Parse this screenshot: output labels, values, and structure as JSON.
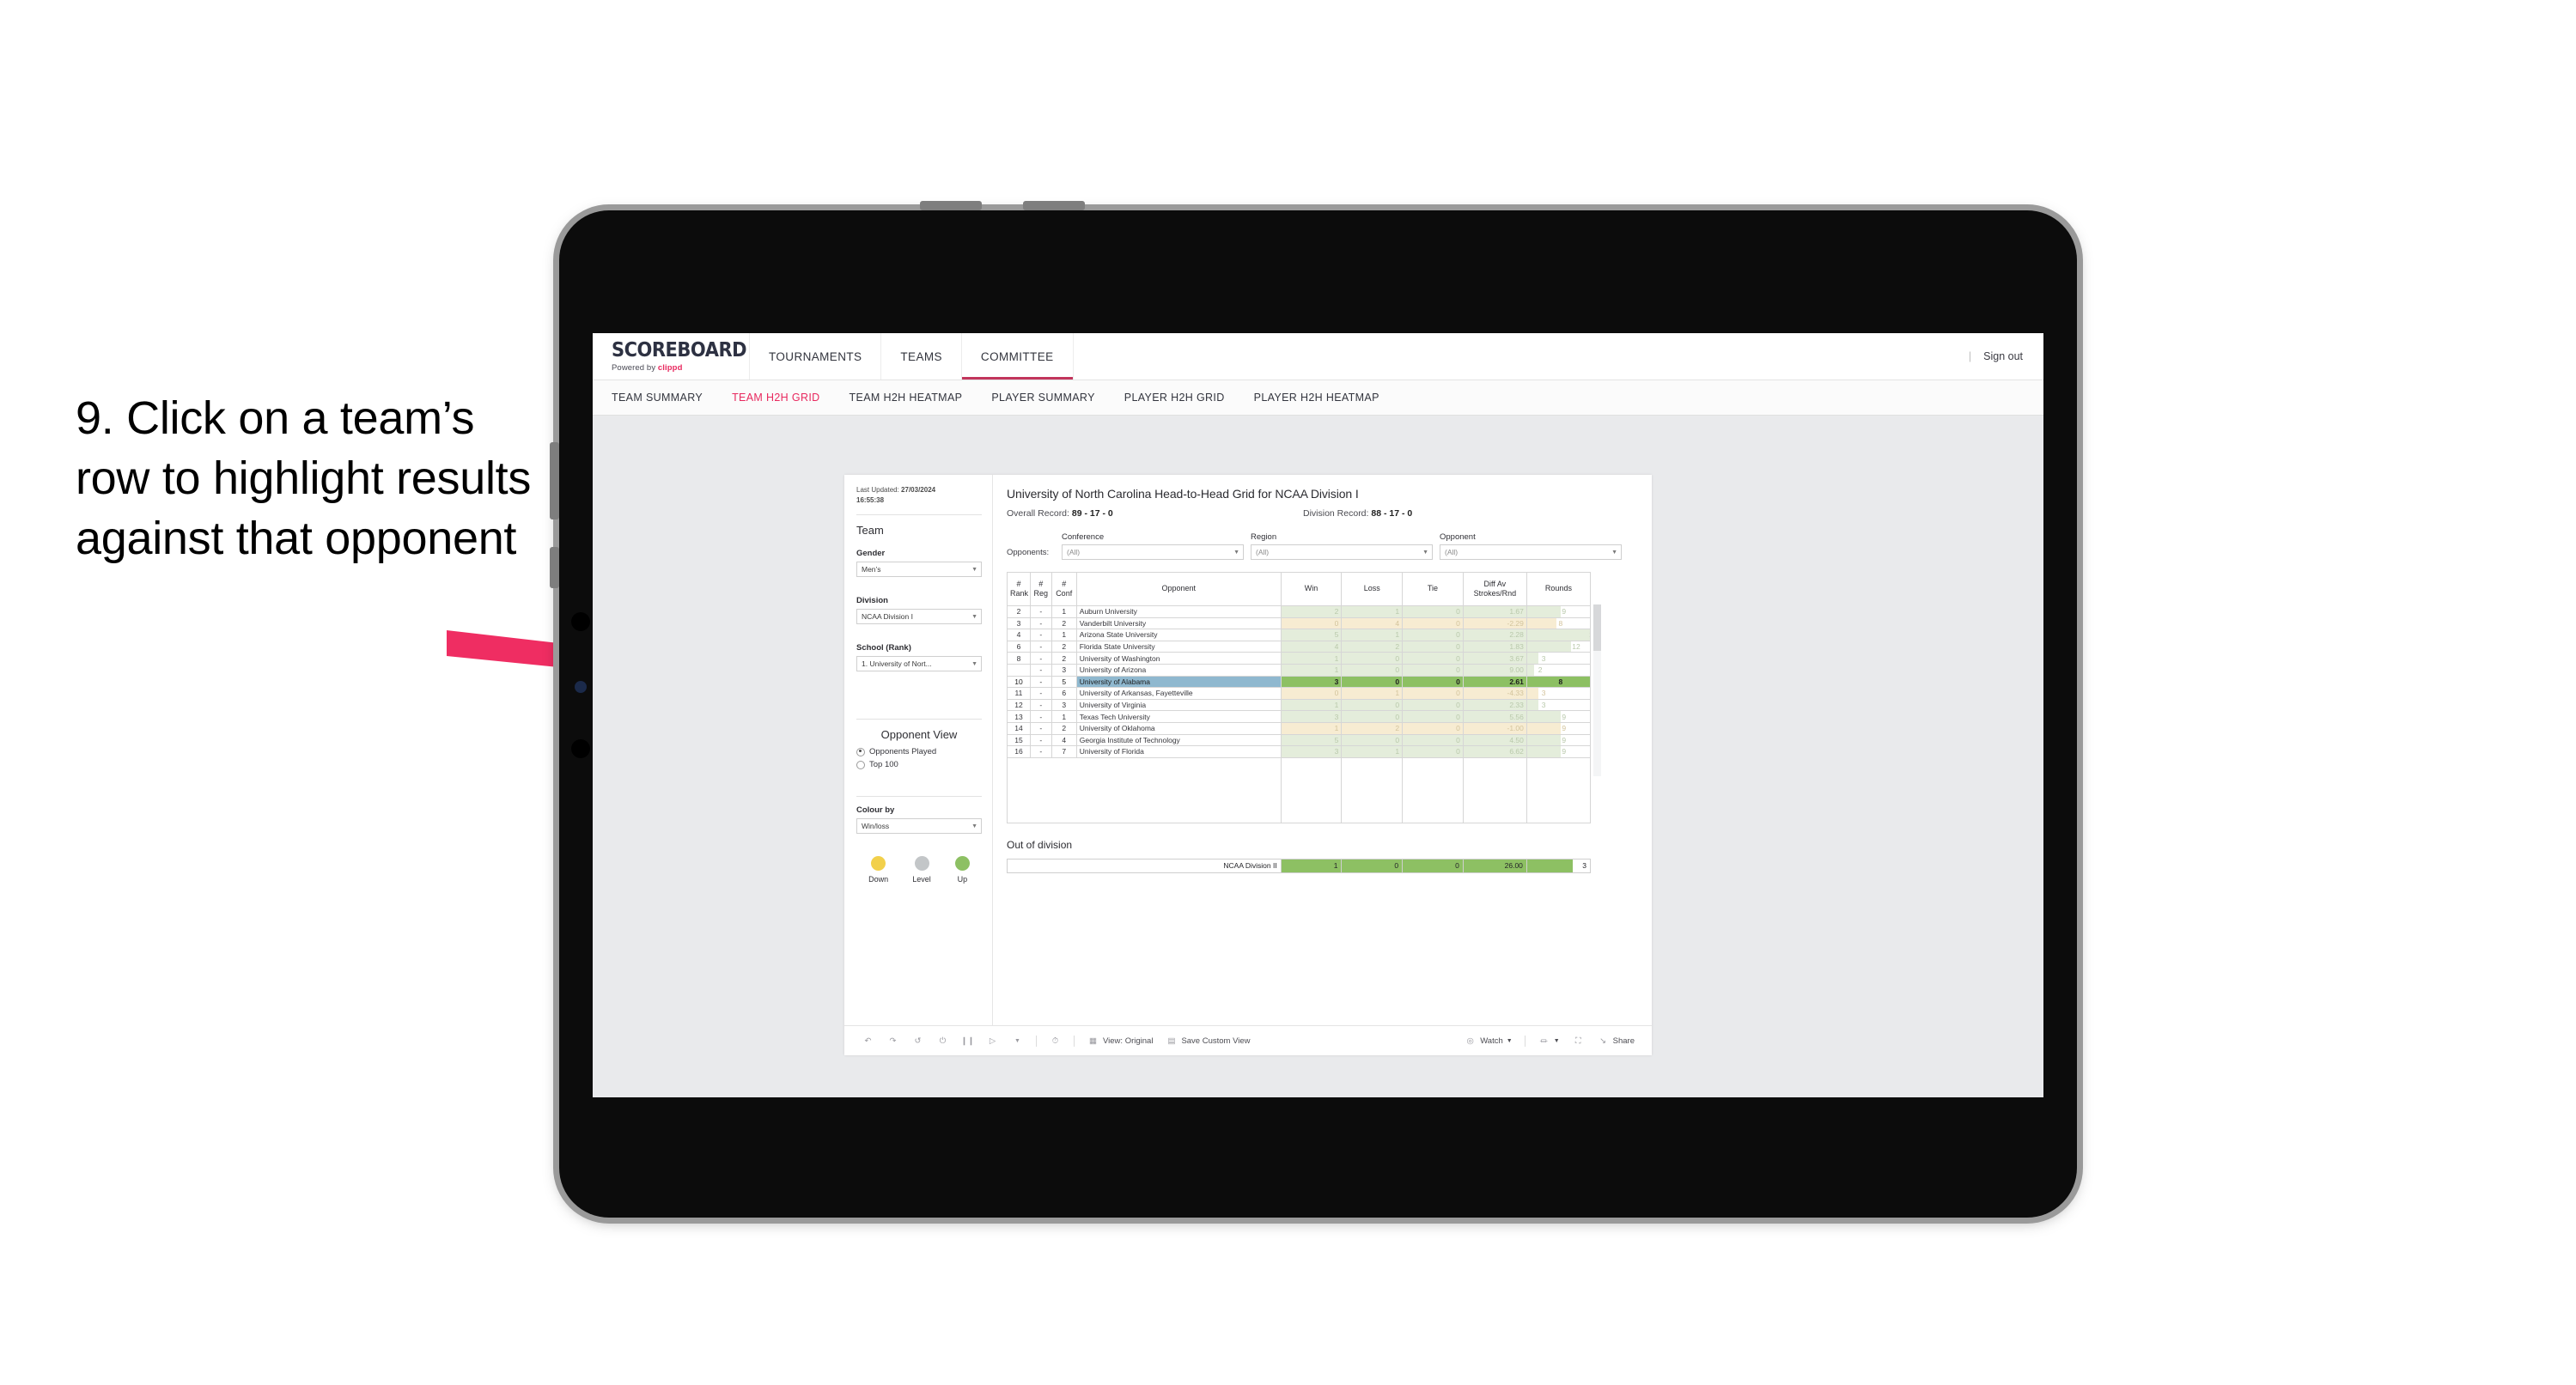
{
  "annotation": {
    "text": "9. Click on a team’s row to highlight results against that opponent",
    "arrow_color": "#ef2d62"
  },
  "topnav": {
    "logo_main": "SCOREBOARD",
    "logo_sub_prefix": "Powered by ",
    "logo_sub_brand": "clippd",
    "items": [
      {
        "label": "TOURNAMENTS",
        "active": false
      },
      {
        "label": "TEAMS",
        "active": false
      },
      {
        "label": "COMMITTEE",
        "active": true
      }
    ],
    "divider": "|",
    "sign_out": "Sign out"
  },
  "subnav": {
    "items": [
      {
        "label": "TEAM SUMMARY",
        "active": false
      },
      {
        "label": "TEAM H2H GRID",
        "active": true
      },
      {
        "label": "TEAM H2H HEATMAP",
        "active": false
      },
      {
        "label": "PLAYER SUMMARY",
        "active": false
      },
      {
        "label": "PLAYER H2H GRID",
        "active": false
      },
      {
        "label": "PLAYER H2H HEATMAP",
        "active": false
      }
    ]
  },
  "sidebar": {
    "last_updated_label": "Last Updated: ",
    "last_updated_date": "27/03/2024",
    "last_updated_time": "16:55:38",
    "team_title": "Team",
    "gender_label": "Gender",
    "gender_value": "Men’s",
    "division_label": "Division",
    "division_value": "NCAA Division I",
    "school_label": "School (Rank)",
    "school_value": "1. University of Nort...",
    "opponent_view_title": "Opponent View",
    "opponent_view_options": [
      {
        "label": "Opponents Played",
        "checked": true
      },
      {
        "label": "Top 100",
        "checked": false
      }
    ],
    "colour_by_label": "Colour by",
    "colour_by_value": "Win/loss",
    "legend": [
      {
        "label": "Down",
        "color": "#f2d04b"
      },
      {
        "label": "Level",
        "color": "#c3c6c8"
      },
      {
        "label": "Up",
        "color": "#8dc063"
      }
    ]
  },
  "main": {
    "title": "University of North Carolina Head-to-Head Grid for NCAA Division I",
    "overall_record_label": "Overall Record: ",
    "overall_record_value": "89 - 17 - 0",
    "division_record_label": "Division Record: ",
    "division_record_value": "88 - 17 - 0",
    "opponents_label": "Opponents:",
    "filters": [
      {
        "label": "Conference",
        "value": "(All)"
      },
      {
        "label": "Region",
        "value": "(All)"
      },
      {
        "label": "Opponent",
        "value": "(All)"
      }
    ],
    "out_of_division_title": "Out of division",
    "out_of_division_row": {
      "label": "NCAA Division II",
      "win": "1",
      "loss": "0",
      "tie": "0",
      "diff": "26.00",
      "rounds": "3"
    }
  },
  "chart_data": {
    "type": "table",
    "title": "University of North Carolina Head-to-Head Grid for NCAA Division I",
    "columns": [
      "# Rank",
      "# Reg",
      "# Conf",
      "Opponent",
      "Win",
      "Loss",
      "Tie",
      "Diff Av Strokes/Rnd",
      "Rounds"
    ],
    "header_lines": [
      [
        "#",
        "Rank"
      ],
      [
        "#",
        "Reg"
      ],
      [
        "#",
        "Conf"
      ],
      [
        "Opponent",
        ""
      ],
      [
        "Win",
        ""
      ],
      [
        "Loss",
        ""
      ],
      [
        "Tie",
        ""
      ],
      [
        "Diff Av",
        "Strokes/Rnd"
      ],
      [
        "Rounds",
        ""
      ]
    ],
    "rounds_max": 17,
    "rows": [
      {
        "rank": "2",
        "reg": "-",
        "conf": "1",
        "opponent": "Auburn University",
        "win": "2",
        "loss": "1",
        "tie": "0",
        "diff": "1.67",
        "rounds": "9",
        "tone": "up",
        "highlight": false
      },
      {
        "rank": "3",
        "reg": "-",
        "conf": "2",
        "opponent": "Vanderbilt University",
        "win": "0",
        "loss": "4",
        "tie": "0",
        "diff": "-2.29",
        "rounds": "8",
        "tone": "down",
        "highlight": false
      },
      {
        "rank": "4",
        "reg": "-",
        "conf": "1",
        "opponent": "Arizona State University",
        "win": "5",
        "loss": "1",
        "tie": "0",
        "diff": "2.28",
        "rounds": "17",
        "tone": "up",
        "highlight": false
      },
      {
        "rank": "6",
        "reg": "-",
        "conf": "2",
        "opponent": "Florida State University",
        "win": "4",
        "loss": "2",
        "tie": "0",
        "diff": "1.83",
        "rounds": "12",
        "tone": "up",
        "highlight": false
      },
      {
        "rank": "8",
        "reg": "-",
        "conf": "2",
        "opponent": "University of Washington",
        "win": "1",
        "loss": "0",
        "tie": "0",
        "diff": "3.67",
        "rounds": "3",
        "tone": "up",
        "highlight": false
      },
      {
        "rank": "",
        "reg": "-",
        "conf": "3",
        "opponent": "University of Arizona",
        "win": "1",
        "loss": "0",
        "tie": "0",
        "diff": "9.00",
        "rounds": "2",
        "tone": "up",
        "highlight": false
      },
      {
        "rank": "10",
        "reg": "-",
        "conf": "5",
        "opponent": "University of Alabama",
        "win": "3",
        "loss": "0",
        "tie": "0",
        "diff": "2.61",
        "rounds": "8",
        "tone": "up",
        "highlight": true
      },
      {
        "rank": "11",
        "reg": "-",
        "conf": "6",
        "opponent": "University of Arkansas, Fayetteville",
        "win": "0",
        "loss": "1",
        "tie": "0",
        "diff": "-4.33",
        "rounds": "3",
        "tone": "down",
        "highlight": false
      },
      {
        "rank": "12",
        "reg": "-",
        "conf": "3",
        "opponent": "University of Virginia",
        "win": "1",
        "loss": "0",
        "tie": "0",
        "diff": "2.33",
        "rounds": "3",
        "tone": "up",
        "highlight": false
      },
      {
        "rank": "13",
        "reg": "-",
        "conf": "1",
        "opponent": "Texas Tech University",
        "win": "3",
        "loss": "0",
        "tie": "0",
        "diff": "5.56",
        "rounds": "9",
        "tone": "up",
        "highlight": false
      },
      {
        "rank": "14",
        "reg": "-",
        "conf": "2",
        "opponent": "University of Oklahoma",
        "win": "1",
        "loss": "2",
        "tie": "0",
        "diff": "-1.00",
        "rounds": "9",
        "tone": "down",
        "highlight": false
      },
      {
        "rank": "15",
        "reg": "-",
        "conf": "4",
        "opponent": "Georgia Institute of Technology",
        "win": "5",
        "loss": "0",
        "tie": "0",
        "diff": "4.50",
        "rounds": "9",
        "tone": "up",
        "highlight": false
      },
      {
        "rank": "16",
        "reg": "-",
        "conf": "7",
        "opponent": "University of Florida",
        "win": "3",
        "loss": "1",
        "tie": "0",
        "diff": "6.62",
        "rounds": "9",
        "tone": "up",
        "highlight": false
      }
    ]
  },
  "toolbar": {
    "view_label": "View: Original",
    "save_label": "Save Custom View",
    "watch_label": "Watch",
    "share_label": "Share",
    "caret": "▾"
  }
}
